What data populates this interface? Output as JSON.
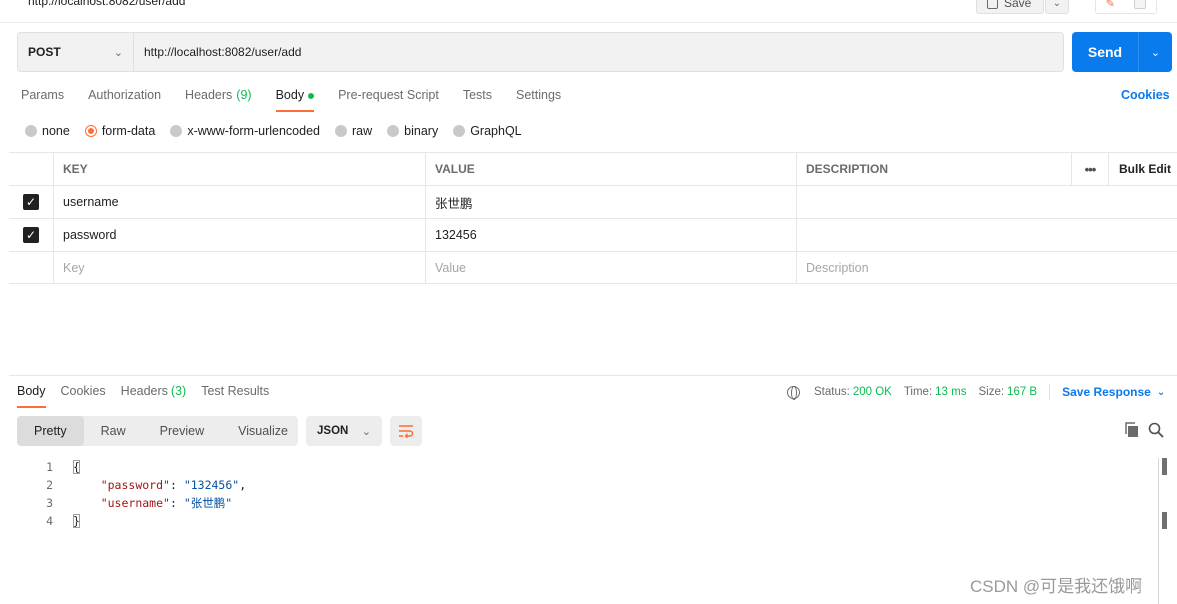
{
  "top": {
    "url_tab": "http://localhost:8082/user/add",
    "save_label": "Save"
  },
  "request": {
    "method": "POST",
    "url": "http://localhost:8082/user/add",
    "send_label": "Send"
  },
  "tabs": {
    "params": "Params",
    "authorization": "Authorization",
    "headers": "Headers",
    "headers_count": "(9)",
    "body": "Body",
    "prerequest": "Pre-request Script",
    "tests": "Tests",
    "settings": "Settings",
    "cookies": "Cookies"
  },
  "body_types": {
    "none": "none",
    "form_data": "form-data",
    "urlencoded": "x-www-form-urlencoded",
    "raw": "raw",
    "binary": "binary",
    "graphql": "GraphQL",
    "selected": "form-data"
  },
  "params_table": {
    "headers": {
      "key": "KEY",
      "value": "VALUE",
      "description": "DESCRIPTION",
      "bulk_edit": "Bulk Edit"
    },
    "rows": [
      {
        "checked": true,
        "key": "username",
        "value": "张世鹏",
        "description": ""
      },
      {
        "checked": true,
        "key": "password",
        "value": "132456",
        "description": ""
      }
    ],
    "placeholders": {
      "key": "Key",
      "value": "Value",
      "description": "Description"
    }
  },
  "response": {
    "tabs": {
      "body": "Body",
      "cookies": "Cookies",
      "headers": "Headers",
      "headers_count": "(3)",
      "test_results": "Test Results"
    },
    "status_label": "Status:",
    "status_value": "200 OK",
    "time_label": "Time:",
    "time_value": "13 ms",
    "size_label": "Size:",
    "size_value": "167 B",
    "save_response": "Save Response",
    "views": {
      "pretty": "Pretty",
      "raw": "Raw",
      "preview": "Preview",
      "visualize": "Visualize"
    },
    "format": "JSON",
    "code": {
      "line_numbers": [
        "1",
        "2",
        "3",
        "4"
      ],
      "open_brace": "{",
      "close_brace": "}",
      "key1": "\"password\"",
      "val1": "\"132456\"",
      "key2": "\"username\"",
      "val2": "\"张世鹏\""
    }
  },
  "watermark": "CSDN @可是我还饿啊",
  "colors": {
    "accent_orange": "#ff6c37",
    "send_blue": "#097bed",
    "success_green": "#0cbb52"
  }
}
